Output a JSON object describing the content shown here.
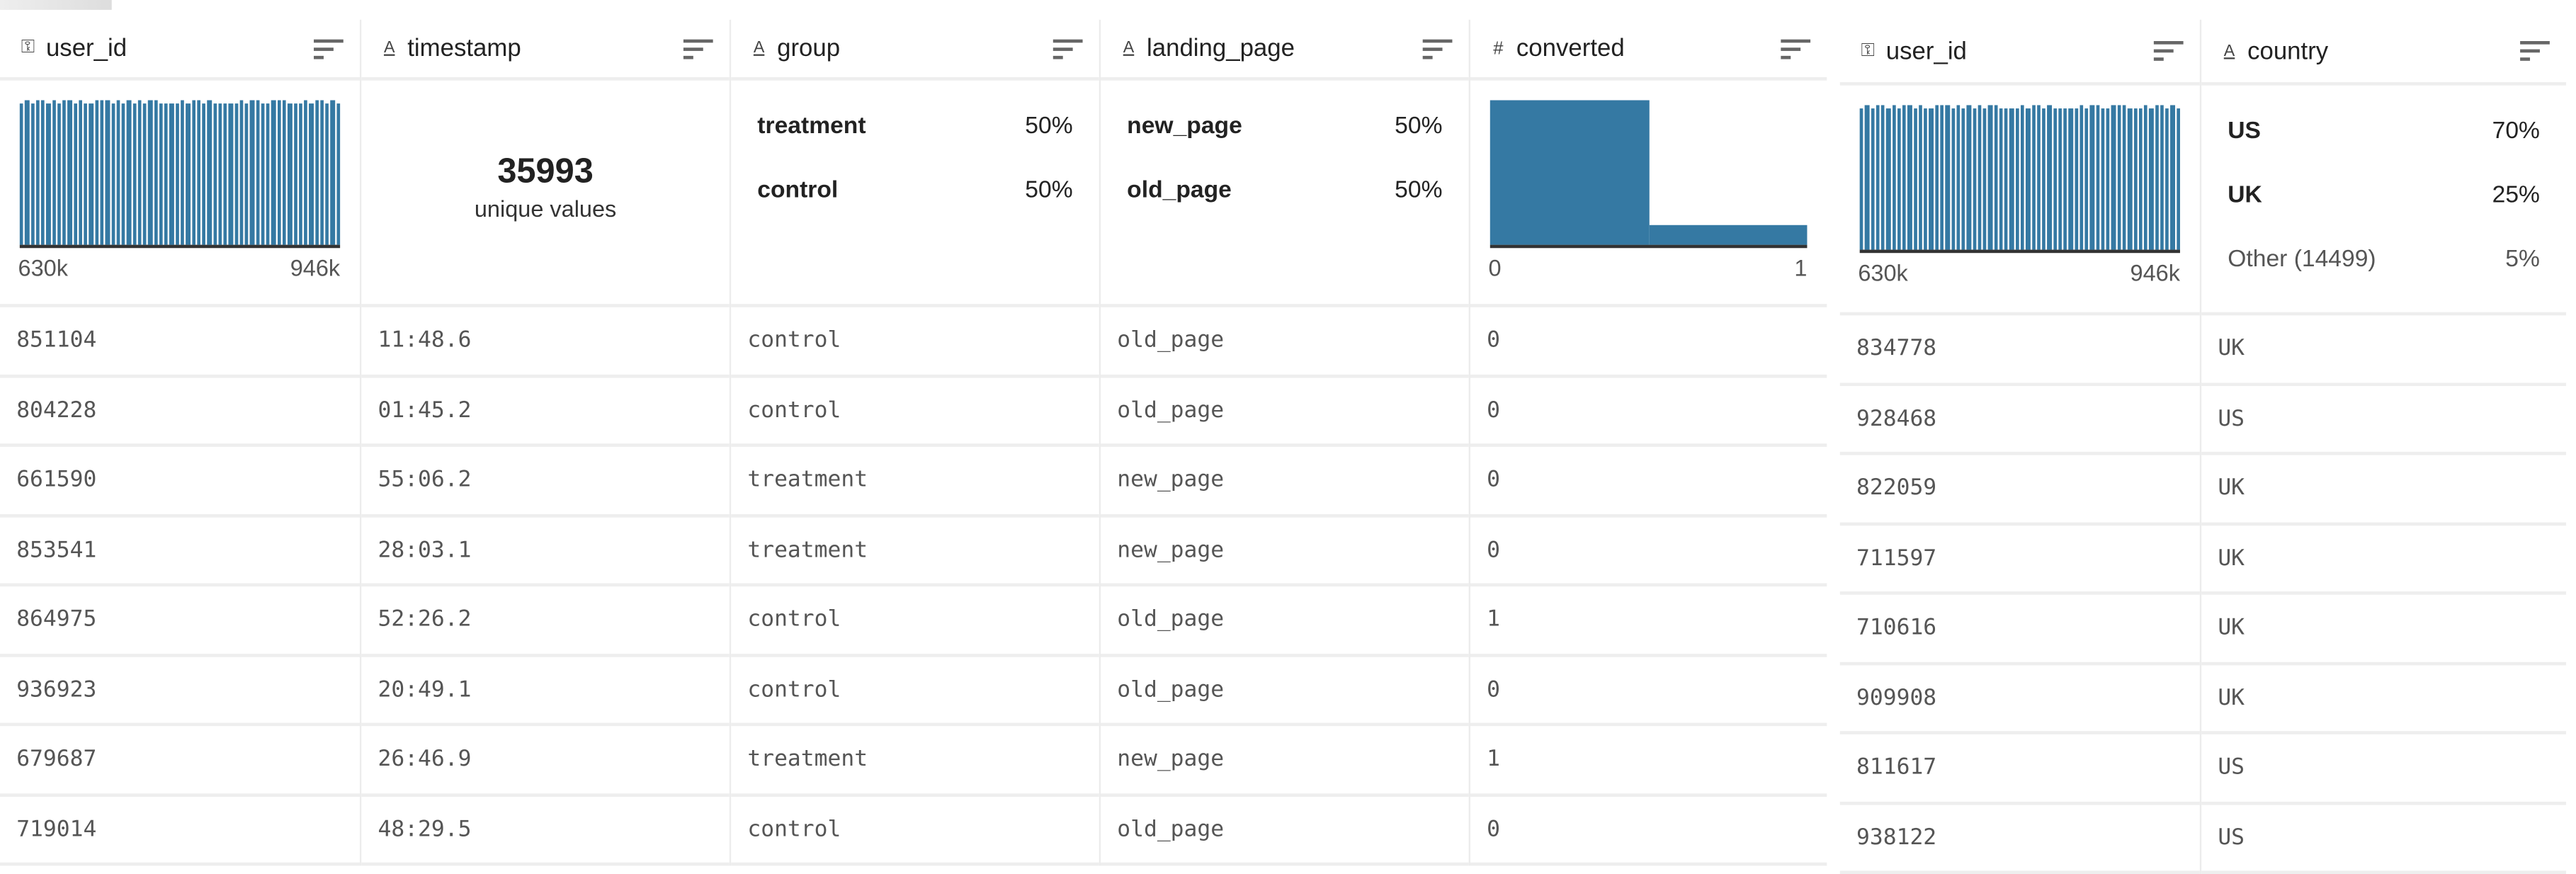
{
  "colors": {
    "bar": "#3579a3",
    "border": "#eeeeee",
    "text": "#222222",
    "muted": "#555555"
  },
  "left_table": {
    "columns": [
      {
        "name": "user_id",
        "type_icon": "key-icon",
        "summary": {
          "kind": "histogram",
          "min_label": "630k",
          "max_label": "946k"
        }
      },
      {
        "name": "timestamp",
        "type_icon": "text-type-icon",
        "summary": {
          "kind": "unique",
          "count": "35993",
          "label": "unique values"
        }
      },
      {
        "name": "group",
        "type_icon": "text-type-icon",
        "summary": {
          "kind": "categories",
          "items": [
            {
              "label": "treatment",
              "pct": "50%"
            },
            {
              "label": "control",
              "pct": "50%"
            }
          ]
        }
      },
      {
        "name": "landing_page",
        "type_icon": "text-type-icon",
        "summary": {
          "kind": "categories",
          "items": [
            {
              "label": "new_page",
              "pct": "50%"
            },
            {
              "label": "old_page",
              "pct": "50%"
            }
          ]
        }
      },
      {
        "name": "converted",
        "type_icon": "number-type-icon",
        "summary": {
          "kind": "histogram2",
          "min_label": "0",
          "max_label": "1",
          "bins": [
            1.0,
            0.14
          ]
        }
      }
    ],
    "rows": [
      [
        "851104",
        "11:48.6",
        "control",
        "old_page",
        "0"
      ],
      [
        "804228",
        "01:45.2",
        "control",
        "old_page",
        "0"
      ],
      [
        "661590",
        "55:06.2",
        "treatment",
        "new_page",
        "0"
      ],
      [
        "853541",
        "28:03.1",
        "treatment",
        "new_page",
        "0"
      ],
      [
        "864975",
        "52:26.2",
        "control",
        "old_page",
        "1"
      ],
      [
        "936923",
        "20:49.1",
        "control",
        "old_page",
        "0"
      ],
      [
        "679687",
        "26:46.9",
        "treatment",
        "new_page",
        "1"
      ],
      [
        "719014",
        "48:29.5",
        "control",
        "old_page",
        "0"
      ]
    ]
  },
  "right_table": {
    "columns": [
      {
        "name": "user_id",
        "type_icon": "key-icon",
        "summary": {
          "kind": "histogram",
          "min_label": "630k",
          "max_label": "946k"
        }
      },
      {
        "name": "country",
        "type_icon": "text-type-icon",
        "summary": {
          "kind": "categories",
          "items": [
            {
              "label": "US",
              "pct": "70%"
            },
            {
              "label": "UK",
              "pct": "25%"
            },
            {
              "label": "Other (14499)",
              "pct": "5%",
              "muted": true
            }
          ]
        }
      }
    ],
    "rows": [
      [
        "834778",
        "UK"
      ],
      [
        "928468",
        "US"
      ],
      [
        "822059",
        "UK"
      ],
      [
        "711597",
        "UK"
      ],
      [
        "710616",
        "UK"
      ],
      [
        "909908",
        "UK"
      ],
      [
        "811617",
        "US"
      ],
      [
        "938122",
        "US"
      ]
    ]
  },
  "user_id_histogram_bins": [
    0.98,
    1,
    0.98,
    1,
    1,
    0.98,
    1,
    0.98,
    1,
    1,
    0.98,
    1,
    0.98,
    0.98,
    1,
    1,
    1,
    0.98,
    1,
    0.98,
    1,
    0.98,
    1,
    0.98,
    1,
    1,
    0.98,
    0.98,
    0.98,
    0.98,
    1,
    0.98,
    1,
    1,
    0.98,
    1,
    0.98,
    0.98,
    0.98,
    0.98,
    0.98,
    1,
    0.98,
    1,
    1,
    0.98,
    0.98,
    1,
    1,
    1,
    0.98,
    0.98,
    0.98,
    1,
    0.98,
    1,
    1,
    0.98,
    1,
    0.98
  ]
}
